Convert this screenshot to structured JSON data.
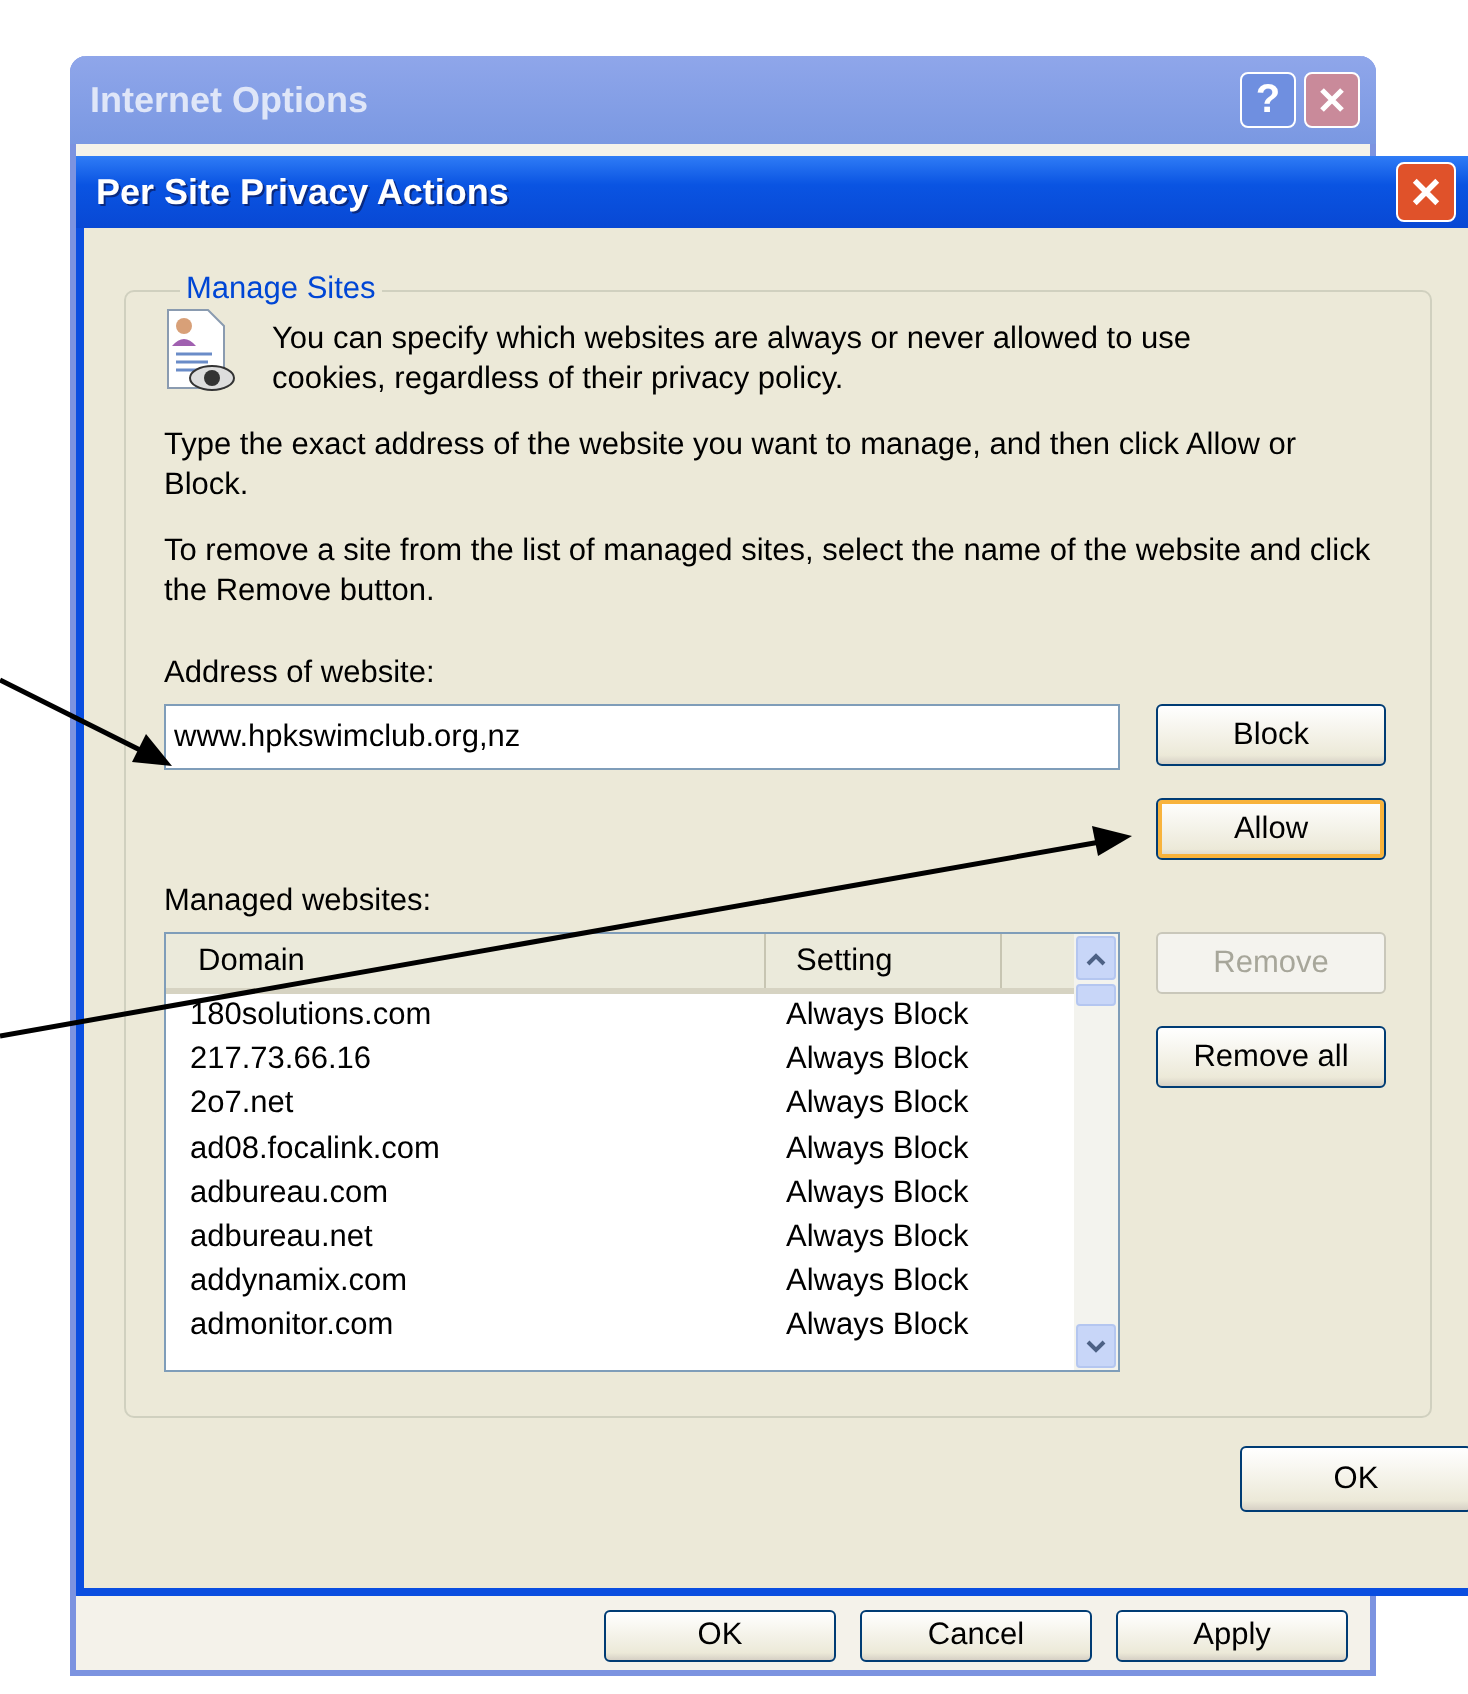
{
  "background_window": {
    "title": "Internet Options",
    "help_button": "?",
    "buttons": [
      "OK",
      "Cancel",
      "Apply"
    ]
  },
  "dialog": {
    "title": "Per Site Privacy Actions"
  },
  "group": {
    "title": "Manage Sites",
    "intro": "You can specify which websites are always or never allowed to use cookies, regardless of their privacy policy.",
    "paragraphs": [
      "Type the exact address of the website you want to manage, and then click Allow or Block.",
      "To remove a site from the list of managed sites, select the name of the website and click the Remove button."
    ]
  },
  "address": {
    "label": "Address of website:",
    "value": "www.hpkswimclub.org,nz"
  },
  "site_buttons": [
    {
      "label": "Block",
      "highlighted": false
    },
    {
      "label": "Allow",
      "highlighted": true
    }
  ],
  "managed": {
    "label": "Managed websites:",
    "columns": [
      "Domain",
      "Setting"
    ],
    "rows": [
      {
        "domain": "180solutions.com",
        "setting": "Always Block"
      },
      {
        "domain": "217.73.66.16",
        "setting": "Always Block"
      },
      {
        "domain": "2o7.net",
        "setting": "Always Block"
      },
      {
        "domain": "ad08.focalink.com",
        "setting": "Always Block"
      },
      {
        "domain": "adbureau.com",
        "setting": "Always Block"
      },
      {
        "domain": "adbureau.net",
        "setting": "Always Block"
      },
      {
        "domain": "addynamix.com",
        "setting": "Always Block"
      },
      {
        "domain": "admonitor.com",
        "setting": "Always Block"
      }
    ]
  },
  "remove_buttons": [
    {
      "label": "Remove",
      "disabled": true
    },
    {
      "label": "Remove all",
      "disabled": false
    }
  ],
  "ok_button": {
    "label": "OK"
  }
}
